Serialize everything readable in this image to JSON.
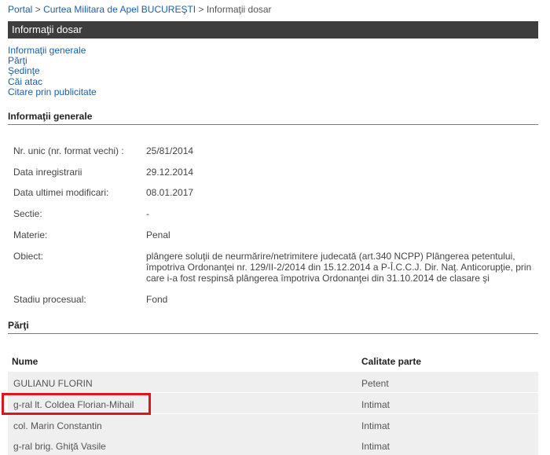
{
  "breadcrumb": {
    "items": [
      "Portal",
      "Curtea Militara de Apel BUCUREŞTI",
      "Informaţii dosar"
    ],
    "separator": ">"
  },
  "title": "Informaţii dosar",
  "nav": {
    "items": [
      "Informaţii generale",
      "Părţi",
      "Şedinţe",
      "Căi atac",
      "Citare prin publicitate"
    ]
  },
  "sections": {
    "general": "Informaţii generale",
    "parti": "Părţi"
  },
  "info": {
    "nr_label": "Nr. unic (nr. format vechi) :",
    "nr_value": "25/81/2014",
    "data_inreg_label": "Data inregistrarii",
    "data_inreg_value": "29.12.2014",
    "data_mod_label": "Data ultimei modificari:",
    "data_mod_value": "08.01.2017",
    "sectie_label": "Sectie:",
    "sectie_value": "-",
    "materie_label": "Materie:",
    "materie_value": "Penal",
    "obiect_label": "Obiect:",
    "obiect_value": "plângere soluţii de neurmărire/netrimitere judecată (art.340 NCPP) Plângerea petentului, împotriva Ordonanţei nr. 129/II-2/2014 din 15.12.2014 a P-Î.C.C.J. Dir. Naţ. Anticorupţie, prin care i-a fost respinsă plângerea împotriva Ordonanţei din 31.10.2014 de clasare şi",
    "stadiu_label": "Stadiu procesual:",
    "stadiu_value": "Fond"
  },
  "parti_table": {
    "headers": {
      "nume": "Nume",
      "calitate": "Calitate parte"
    },
    "rows": [
      {
        "nume": "GULIANU FLORIN",
        "calitate": "Petent"
      },
      {
        "nume": "g-ral lt. Coldea Florian-Mihail",
        "calitate": "Intimat"
      },
      {
        "nume": "col. Marin Constantin",
        "calitate": "Intimat"
      },
      {
        "nume": "g-ral brig. Ghiţă Vasile",
        "calitate": "Intimat"
      }
    ]
  },
  "colors": {
    "link": "#1a5fa8",
    "titlebar": "#3d3d3d",
    "row_bg": "#efefef",
    "highlight": "#e0141e"
  }
}
